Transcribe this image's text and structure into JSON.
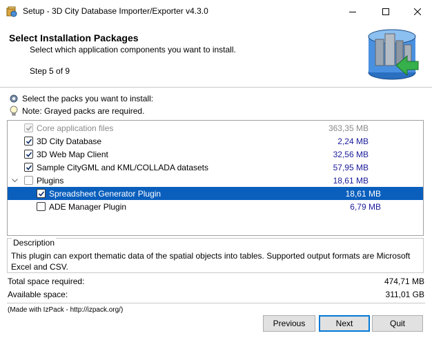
{
  "window": {
    "title": "Setup - 3D City Database Importer/Exporter v4.3.0",
    "app_icon": "setup-app-icon",
    "controls": [
      "minimize-icon",
      "maximize-icon",
      "close-icon"
    ]
  },
  "header": {
    "title": "Select Installation Packages",
    "subtitle": "Select which application components you want to install.",
    "step": "Step 5 of 9",
    "logo_icon": "3dcitydb-logo"
  },
  "info": {
    "select_text": "Select the packs you want to install:",
    "select_icon": "gear-icon",
    "note_text": "Note: Grayed packs are required.",
    "note_icon": "lightbulb-icon"
  },
  "packs": [
    {
      "name": "Core application files",
      "size": "363,35 MB",
      "checked": true,
      "required": true,
      "level": 0
    },
    {
      "name": "3D City Database",
      "size": "2,24 MB",
      "checked": true,
      "required": false,
      "level": 0
    },
    {
      "name": "3D Web Map Client",
      "size": "32,56 MB",
      "checked": true,
      "required": false,
      "level": 0
    },
    {
      "name": "Sample CityGML and KML/COLLADA datasets",
      "size": "57,95 MB",
      "checked": true,
      "required": false,
      "level": 0
    },
    {
      "name": "Plugins",
      "size": "18,61 MB",
      "checked": false,
      "required": false,
      "level": 0,
      "expanded": true
    },
    {
      "name": "Spreadsheet Generator Plugin",
      "size": "18,61 MB",
      "checked": true,
      "required": false,
      "level": 1,
      "selected": true
    },
    {
      "name": "ADE Manager Plugin",
      "size": "6,79 MB",
      "checked": false,
      "required": false,
      "level": 1
    }
  ],
  "description": {
    "legend": "Description",
    "text": "This plugin can export thematic data of the spatial objects into tables. Supported output formats are Microsoft Excel and CSV."
  },
  "space": {
    "required_label": "Total space required:",
    "required_value": "474,71 MB",
    "available_label": "Available space:",
    "available_value": "311,01 GB"
  },
  "credit": "(Made with IzPack - http://izpack.org/)",
  "buttons": {
    "previous": "Previous",
    "next": "Next",
    "quit": "Quit"
  },
  "colors": {
    "selection": "#0a5fbd",
    "size_text": "#1a1a9a",
    "default_button_border": "#0078d7"
  }
}
